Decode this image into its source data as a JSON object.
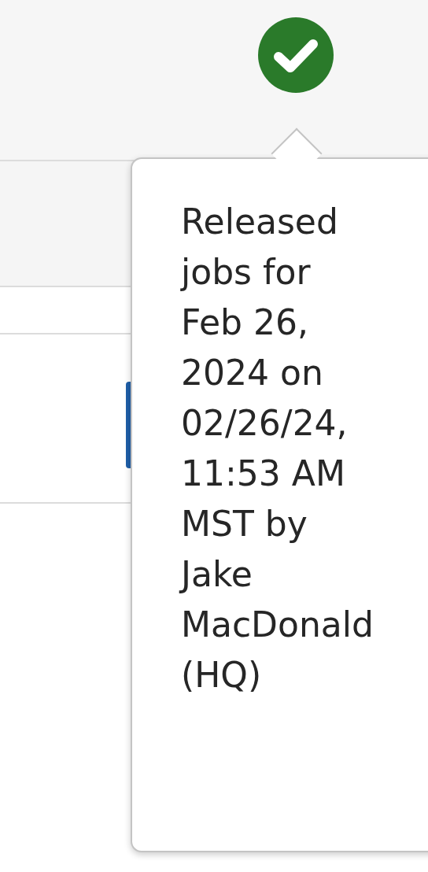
{
  "status_icon": {
    "kind": "success"
  },
  "tooltip": {
    "text": "Released jobs for Feb 26, 2024 on 02/26/24, 11:53 AM MST by Jake MacDonald (HQ)"
  }
}
